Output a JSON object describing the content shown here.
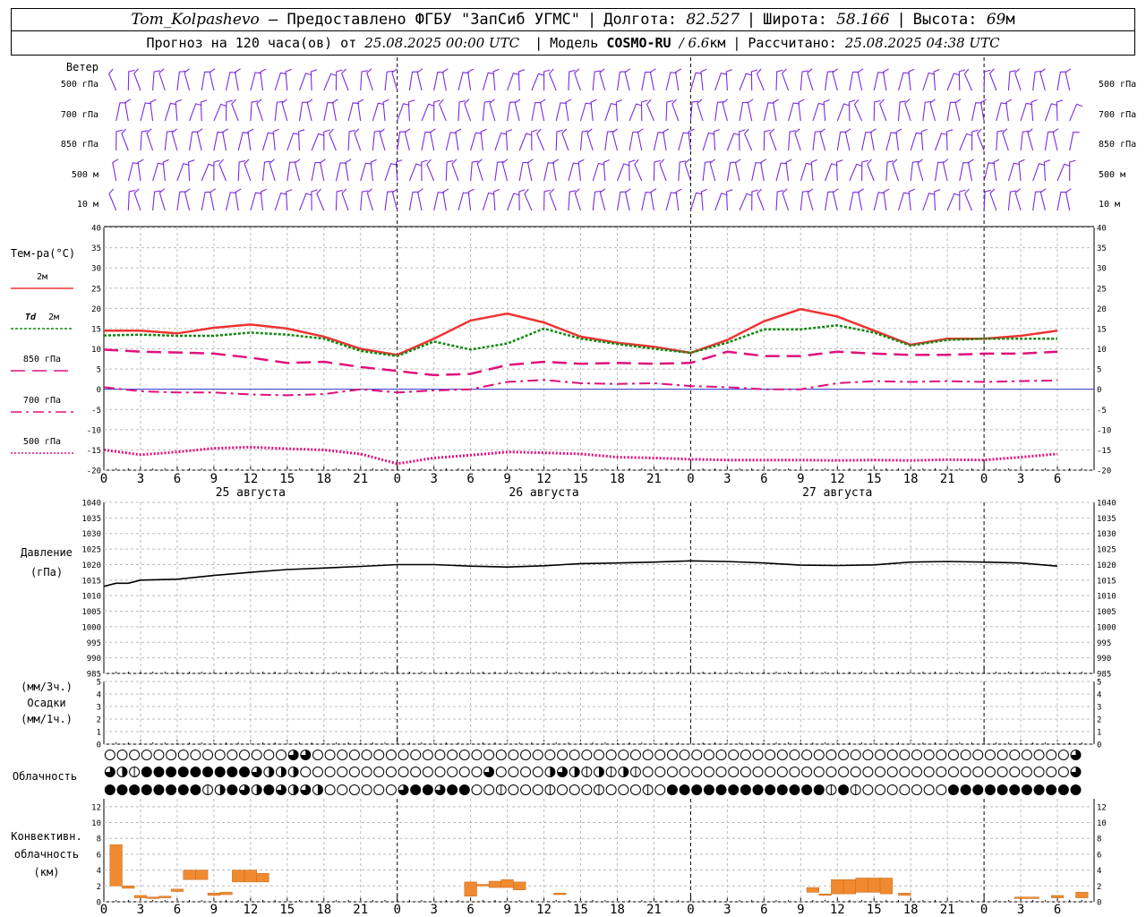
{
  "header": {
    "station": "Tom_Kolpashevo",
    "provider": "— Предоставлено ФГБУ \"ЗапСиб УГМС\"",
    "lon_label": "Долгота:",
    "lon_value": "82.527",
    "lat_label": "Широта:",
    "lat_value": "58.166",
    "alt_label": "Высота:",
    "alt_value": "69",
    "alt_unit": "м",
    "forecast_label": "Прогноз на 120 часа(ов) от",
    "forecast_start": "25.08.2025 00:00 UTC",
    "model_label": "Модель",
    "model_name": "COSMO-RU",
    "model_res": "/ 6.6",
    "model_res_unit": "км",
    "calc_label": "Рассчитано:",
    "calc_time": "25.08.2025 04:38 UTC"
  },
  "colors": {
    "t2m": "#ee3333",
    "td2m": "#118811",
    "levels": "#e0107a",
    "wind": "#7a2be0",
    "conv": "#f08a30",
    "zero": "#3333cc"
  },
  "time_axis": {
    "hour_labels": [
      "0",
      "3",
      "6",
      "9",
      "12",
      "15",
      "18",
      "21",
      "0",
      "3",
      "6",
      "9",
      "12",
      "15",
      "18",
      "21",
      "0",
      "3",
      "6",
      "9",
      "12",
      "15",
      "18",
      "21",
      "0",
      "3",
      "6"
    ],
    "day_labels": [
      "25 августа",
      "26 августа",
      "27 августа"
    ]
  },
  "wind_panel": {
    "title": "Ветер",
    "levels": [
      "500 гПа",
      "700 гПа",
      "850 гПа",
      "500 м",
      "10  м"
    ],
    "right_levels": [
      "500 гПа",
      "700 гПа",
      "850 гПа",
      "500 м",
      "10  м"
    ],
    "barb_icon": "wind-barb-icon"
  },
  "cloud_panel": {
    "title": "Облачность",
    "icon": "cloud-cover-circle-icon"
  },
  "chart_data": [
    {
      "type": "line",
      "title": "Тем-ра(°C)",
      "ylim": [
        -20,
        40
      ],
      "yticks": [
        "40",
        "35",
        "30",
        "25",
        "20",
        "15",
        "10",
        "5",
        "0",
        "-5",
        "-10",
        "-15",
        "-20"
      ],
      "legend": [
        {
          "name": "2м",
          "style": "solid"
        },
        {
          "prefix": "Td",
          "name": "2м",
          "style": "dotted"
        },
        {
          "name": "850 гПа",
          "style": "dashed"
        },
        {
          "name": "700 гПа",
          "style": "dashdot"
        },
        {
          "name": "500 гПа",
          "style": "fine-dotted"
        }
      ],
      "x": [
        0,
        3,
        6,
        9,
        12,
        15,
        18,
        21,
        24,
        27,
        30,
        33,
        36,
        39,
        42,
        45,
        48,
        51,
        54,
        57,
        60,
        63,
        66,
        69,
        72,
        75,
        78
      ],
      "series": [
        {
          "name": "2м",
          "values": [
            14.5,
            14.5,
            13.8,
            15.2,
            16,
            15,
            13,
            10,
            8.5,
            12.5,
            17,
            18.7,
            16.5,
            13,
            11.5,
            10.5,
            9,
            12.2,
            16.8,
            19.8,
            18,
            14.5,
            11,
            12.5,
            12.5,
            13.2,
            14.5
          ]
        },
        {
          "name": "Td 2м",
          "values": [
            13.3,
            13.5,
            13.2,
            13.2,
            14,
            13.5,
            12.5,
            9.5,
            8.2,
            11.8,
            9.8,
            11.3,
            15,
            12.5,
            11.2,
            10,
            9,
            11.5,
            14.8,
            14.8,
            15.8,
            14,
            10.8,
            12.2,
            12.5,
            12.5,
            12.5
          ]
        },
        {
          "name": "850 гПа",
          "values": [
            9.8,
            9.3,
            9.1,
            8.8,
            7.8,
            6.5,
            6.8,
            5.5,
            4.5,
            3.5,
            3.8,
            6,
            6.8,
            6.3,
            6.5,
            6.3,
            6.5,
            9.3,
            8.2,
            8.2,
            9.3,
            8.8,
            8.5,
            8.5,
            8.8,
            8.8,
            9.3
          ]
        },
        {
          "name": "700 гПа",
          "values": [
            0.5,
            -0.5,
            -0.8,
            -0.8,
            -1.3,
            -1.5,
            -1.2,
            0,
            -0.8,
            -0.3,
            0,
            1.8,
            2.3,
            1.5,
            1.3,
            1.5,
            0.8,
            0.5,
            0,
            0,
            1.5,
            2,
            1.8,
            2,
            1.8,
            2,
            2.2
          ]
        },
        {
          "name": "500 гПа",
          "values": [
            -15,
            -16.2,
            -15.5,
            -14.6,
            -14.3,
            -14.7,
            -15,
            -16,
            -18.4,
            -17,
            -16.3,
            -15.5,
            -15.7,
            -16,
            -16.8,
            -17,
            -17.3,
            -17.5,
            -17.5,
            -17.5,
            -17.6,
            -17.5,
            -17.6,
            -17.4,
            -17.5,
            -16.8,
            -16
          ]
        }
      ]
    },
    {
      "type": "line",
      "title": "Давление",
      "ylabel": "(гПа)",
      "ylim": [
        985,
        1040
      ],
      "yticks": [
        "1040",
        "1035",
        "1030",
        "1025",
        "1020",
        "1015",
        "1010",
        "1005",
        "1000",
        "995",
        "990",
        "985"
      ],
      "x": [
        0,
        1,
        2,
        3,
        6,
        9,
        12,
        15,
        18,
        21,
        24,
        27,
        30,
        33,
        36,
        39,
        42,
        45,
        48,
        51,
        54,
        57,
        60,
        63,
        66,
        69,
        72,
        75,
        78
      ],
      "series": [
        {
          "name": "Давление",
          "values": [
            1013,
            1014,
            1014,
            1015,
            1015.3,
            1016.5,
            1017.5,
            1018.4,
            1018.9,
            1019.4,
            1020,
            1020,
            1019.5,
            1019.2,
            1019.6,
            1020.3,
            1020.5,
            1020.8,
            1021.2,
            1021,
            1020.5,
            1019.8,
            1019.7,
            1019.9,
            1020.8,
            1021,
            1020.8,
            1020.5,
            1019.5
          ]
        }
      ]
    },
    {
      "type": "bar",
      "title": "Осадки",
      "ylabel": "(мм/3ч.)",
      "y2label": "(мм/1ч.)",
      "ylim": [
        0,
        5
      ],
      "yticks": [
        "5",
        "4",
        "3",
        "2",
        "1",
        "0"
      ],
      "series": [
        {
          "values": []
        }
      ]
    },
    {
      "type": "bar",
      "title": "Конвективн. облачность",
      "ylabel": "(км)",
      "ylim": [
        0,
        13
      ],
      "yticks": [
        "12",
        "10",
        "8",
        "6",
        "4",
        "2",
        "0"
      ],
      "bars": [
        {
          "x0": 0.5,
          "x1": 1.5,
          "lo": 2,
          "hi": 7.2
        },
        {
          "x0": 1.5,
          "x1": 2.5,
          "lo": 1.7,
          "hi": 2
        },
        {
          "x0": 2.5,
          "x1": 3.5,
          "lo": 0.5,
          "hi": 0.8
        },
        {
          "x0": 3.5,
          "x1": 4.5,
          "lo": 0.4,
          "hi": 0.6
        },
        {
          "x0": 4.5,
          "x1": 5.5,
          "lo": 0.5,
          "hi": 0.7
        },
        {
          "x0": 5.5,
          "x1": 6.5,
          "lo": 1.3,
          "hi": 1.6
        },
        {
          "x0": 6.5,
          "x1": 7.5,
          "lo": 2.8,
          "hi": 4
        },
        {
          "x0": 7.5,
          "x1": 8.5,
          "lo": 2.8,
          "hi": 4
        },
        {
          "x0": 8.5,
          "x1": 9.5,
          "lo": 0.8,
          "hi": 1.1
        },
        {
          "x0": 9.5,
          "x1": 10.5,
          "lo": 0.9,
          "hi": 1.2
        },
        {
          "x0": 10.5,
          "x1": 11.5,
          "lo": 2.5,
          "hi": 4
        },
        {
          "x0": 11.5,
          "x1": 12.5,
          "lo": 2.5,
          "hi": 4
        },
        {
          "x0": 12.5,
          "x1": 13.5,
          "lo": 2.5,
          "hi": 3.6
        },
        {
          "x0": 29.5,
          "x1": 30.5,
          "lo": 0.7,
          "hi": 2.5
        },
        {
          "x0": 30.5,
          "x1": 31.5,
          "lo": 2,
          "hi": 2.2
        },
        {
          "x0": 31.5,
          "x1": 32.5,
          "lo": 1.8,
          "hi": 2.6
        },
        {
          "x0": 32.5,
          "x1": 33.5,
          "lo": 1.8,
          "hi": 2.8
        },
        {
          "x0": 33.5,
          "x1": 34.5,
          "lo": 1.5,
          "hi": 2.5
        },
        {
          "x0": 36.8,
          "x1": 37.8,
          "lo": 0.9,
          "hi": 1.1
        },
        {
          "x0": 57.5,
          "x1": 58.5,
          "lo": 1.2,
          "hi": 1.8
        },
        {
          "x0": 58.5,
          "x1": 59.5,
          "lo": 0.8,
          "hi": 1
        },
        {
          "x0": 59.5,
          "x1": 60.5,
          "lo": 1,
          "hi": 2.8
        },
        {
          "x0": 60.5,
          "x1": 61.5,
          "lo": 1,
          "hi": 2.8
        },
        {
          "x0": 61.5,
          "x1": 62.5,
          "lo": 1.2,
          "hi": 3
        },
        {
          "x0": 62.5,
          "x1": 63.5,
          "lo": 1.2,
          "hi": 3
        },
        {
          "x0": 63.5,
          "x1": 64.5,
          "lo": 1,
          "hi": 3
        },
        {
          "x0": 65,
          "x1": 66,
          "lo": 0.8,
          "hi": 1.1
        },
        {
          "x0": 74.5,
          "x1": 76.5,
          "lo": 0.4,
          "hi": 0.6
        },
        {
          "x0": 77.5,
          "x1": 78.5,
          "lo": 0.5,
          "hi": 0.8
        },
        {
          "x0": 79.5,
          "x1": 80.5,
          "lo": 0.5,
          "hi": 1.2
        }
      ]
    }
  ]
}
